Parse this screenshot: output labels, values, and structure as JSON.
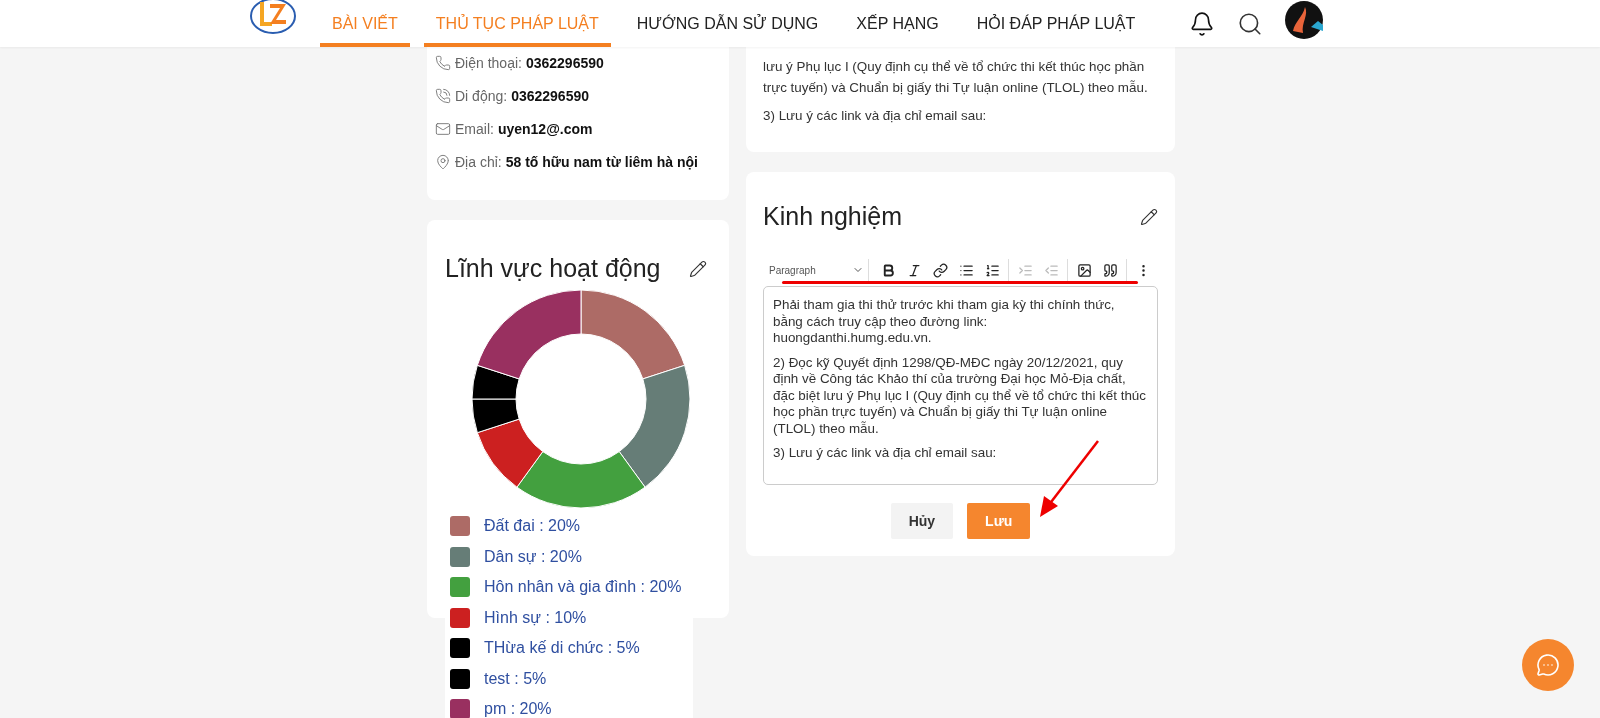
{
  "header": {
    "nav": [
      {
        "label": "BÀI VIẾT",
        "selected": true
      },
      {
        "label": "THỦ TỤC PHÁP LUẬT",
        "selected": true
      },
      {
        "label": "HƯỚNG DẪN SỬ DỤNG",
        "selected": false
      },
      {
        "label": "XẾP HẠNG",
        "selected": false
      },
      {
        "label": "HỎI ĐÁP PHÁP LUẬT",
        "selected": false
      }
    ]
  },
  "contact": [
    {
      "kind": "phone",
      "label": "Điện thoại:",
      "value": "0362296590"
    },
    {
      "kind": "mobile",
      "label": "Di động:",
      "value": "0362296590"
    },
    {
      "kind": "email",
      "label": "Email:",
      "value": "uyen12@.com"
    },
    {
      "kind": "address",
      "label": "Địa chỉ:",
      "value": "58 tố hữu nam từ liêm hà nội"
    }
  ],
  "fields_card": {
    "title": "Lĩnh vực hoạt động",
    "chart_data": {
      "type": "donut",
      "values": [
        20,
        20,
        20,
        10,
        5,
        5,
        20
      ]
    },
    "legend": [
      {
        "label": "Đất đai : 20%",
        "color": "#ad6b66"
      },
      {
        "label": "Dân sự : 20%",
        "color": "#667d77"
      },
      {
        "label": "Hôn nhân và gia đình : 20%",
        "color": "#43a03f"
      },
      {
        "label": "Hình sự : 10%",
        "color": "#cc2020"
      },
      {
        "label": "THừa kế di chức : 5%",
        "color": "#000000"
      },
      {
        "label": "test : 5%",
        "color": "#000000"
      },
      {
        "label": "pm : 20%",
        "color": "#993060"
      }
    ]
  },
  "article_card": {
    "paragraphs": [
      "lưu ý Phụ lục I (Quy định cụ thể về tổ chức thi kết thúc học phần trực tuyến) và Chuẩn bị giấy thi Tự luận online (TLOL) theo mẫu.",
      "3) Lưu ý các link và địa chỉ email sau:"
    ]
  },
  "experience_card": {
    "title": "Kinh nghiệm",
    "toolbar": {
      "format": "Paragraph",
      "tools": [
        {
          "kind": "bold",
          "disabled": false
        },
        {
          "kind": "italic",
          "disabled": false
        },
        {
          "kind": "link",
          "disabled": false
        },
        {
          "kind": "bullets",
          "disabled": false
        },
        {
          "kind": "numbers",
          "disabled": false
        },
        {
          "kind": "indent",
          "disabled": true
        },
        {
          "kind": "outdent",
          "disabled": true
        },
        {
          "kind": "image",
          "disabled": false
        },
        {
          "kind": "quote",
          "disabled": false
        },
        {
          "kind": "more",
          "disabled": false
        }
      ]
    },
    "paragraphs": [
      "Phải tham gia thi thử trước khi tham gia kỳ thi chính thức, bằng cách truy cập theo đường link: huongdanthi.humg.edu.vn.",
      "2) Đọc kỹ Quyết định 1298/QĐ-MĐC ngày 20/12/2021, quy định về Công tác Khảo thí của trường Đại học Mỏ-Địa chất, đặc biệt lưu ý Phụ lục I (Quy định cụ thể về tổ chức thi kết thúc học phần trực tuyến) và Chuẩn bị giấy thi Tự luận online (TLOL) theo mẫu.",
      "3) Lưu ý các link và địa chỉ email sau:"
    ],
    "buttons": [
      {
        "kind": "cancel",
        "label": "Hủy"
      },
      {
        "kind": "save",
        "label": "Lưu"
      }
    ]
  }
}
